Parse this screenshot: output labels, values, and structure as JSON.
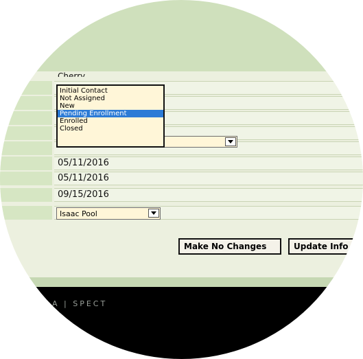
{
  "form": {
    "partial_name": "Cherry",
    "dates": [
      "05/11/2016",
      "05/11/2016",
      "09/15/2016"
    ],
    "assigned_to": "Isaac Pool"
  },
  "status_dropdown": {
    "options": [
      "Initial Contact",
      "Not Assigned",
      "New",
      "Pending Enrollment",
      "Enrolled",
      "Closed"
    ],
    "highlighted": "Pending Enrollment"
  },
  "buttons": {
    "make_no_changes": "Make No Changes",
    "update_info": "Update Info"
  },
  "footer": {
    "text": "A | SPECT"
  },
  "colors": {
    "header_green": "#cfe0bc",
    "form_bg": "#ecf0df",
    "highlight_blue": "#2c7bd6",
    "footer_black": "#000000"
  }
}
